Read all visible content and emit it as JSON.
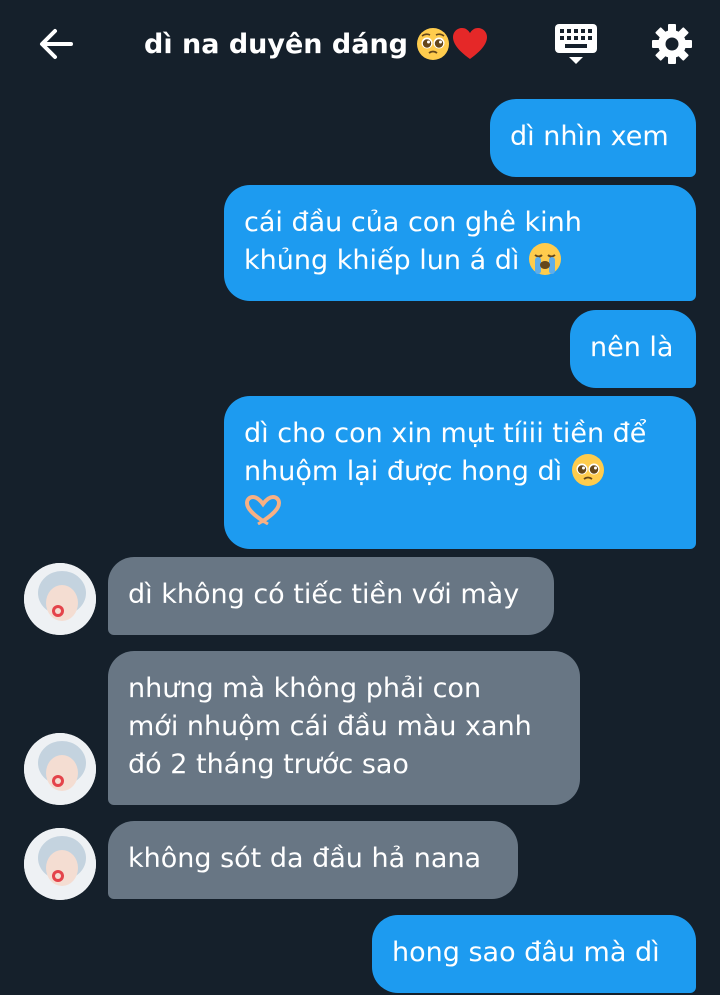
{
  "header": {
    "title": "dì na duyên dáng",
    "title_emojis": [
      "pleading-face",
      "red-heart"
    ]
  },
  "messages": [
    {
      "side": "out",
      "text": "dì nhìn xem"
    },
    {
      "side": "out",
      "lines": [
        "cái đầu của con ghê kinh",
        "khủng khiếp lun á dì"
      ],
      "emojis": [
        "loudly-crying-face"
      ]
    },
    {
      "side": "out",
      "text": "nên là"
    },
    {
      "side": "out",
      "lines": [
        "dì cho con xin mụt tíiii tiền để",
        "nhuộm lại được hong dì"
      ],
      "emojis": [
        "pleading-face",
        "heart-hands"
      ]
    },
    {
      "side": "in",
      "text": "dì không có tiếc tiền với mày"
    },
    {
      "side": "in",
      "lines": [
        "nhưng mà không phải con",
        "mới nhuộm cái đầu màu xanh",
        "đó 2 tháng trước sao"
      ]
    },
    {
      "side": "in",
      "text": "không sót da đầu hả nana"
    },
    {
      "side": "out",
      "text": "hong sao đâu mà dì"
    }
  ],
  "colors": {
    "background": "#15202b",
    "outgoing_bubble": "#1d9bf0",
    "incoming_bubble": "#687684",
    "text": "#ffffff"
  },
  "icons": [
    "back-arrow-icon",
    "keyboard-icon",
    "gear-icon"
  ]
}
